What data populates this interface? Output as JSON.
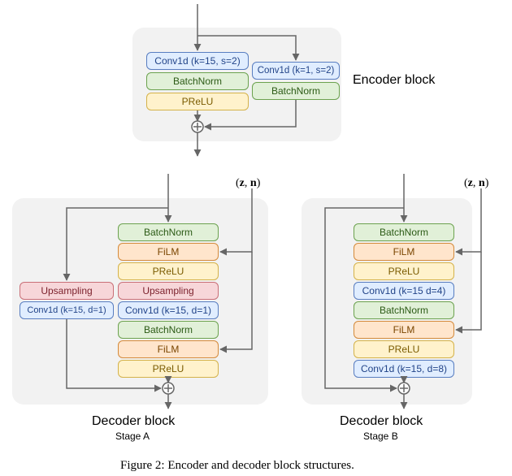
{
  "encoder": {
    "title": "Encoder block",
    "conv_main": "Conv1d (k=15, s=2)",
    "bn_main": "BatchNorm",
    "prelu_main": "PReLU",
    "conv_skip": "Conv1d (k=1, s=2)",
    "bn_skip": "BatchNorm"
  },
  "decoderA": {
    "title": "Decoder block",
    "stage": "Stage A",
    "bn1": "BatchNorm",
    "film1": "FiLM",
    "prelu1": "PReLU",
    "ups_main": "Upsampling",
    "conv_main": "Conv1d (k=15, d=1)",
    "bn2": "BatchNorm",
    "film2": "FiLM",
    "prelu2": "PReLU",
    "ups_skip": "Upsampling",
    "conv_skip": "Conv1d (k=15, d=1)"
  },
  "decoderB": {
    "title": "Decoder block",
    "stage": "Stage B",
    "bn1": "BatchNorm",
    "film1": "FiLM",
    "prelu1": "PReLU",
    "conv1": "Conv1d (k=15 d=4)",
    "bn2": "BatchNorm",
    "film2": "FiLM",
    "prelu2": "PReLU",
    "conv2": "Conv1d (k=15, d=8)"
  },
  "zn_label": "(z, n)",
  "caption": "Figure 2: Encoder and decoder block structures."
}
